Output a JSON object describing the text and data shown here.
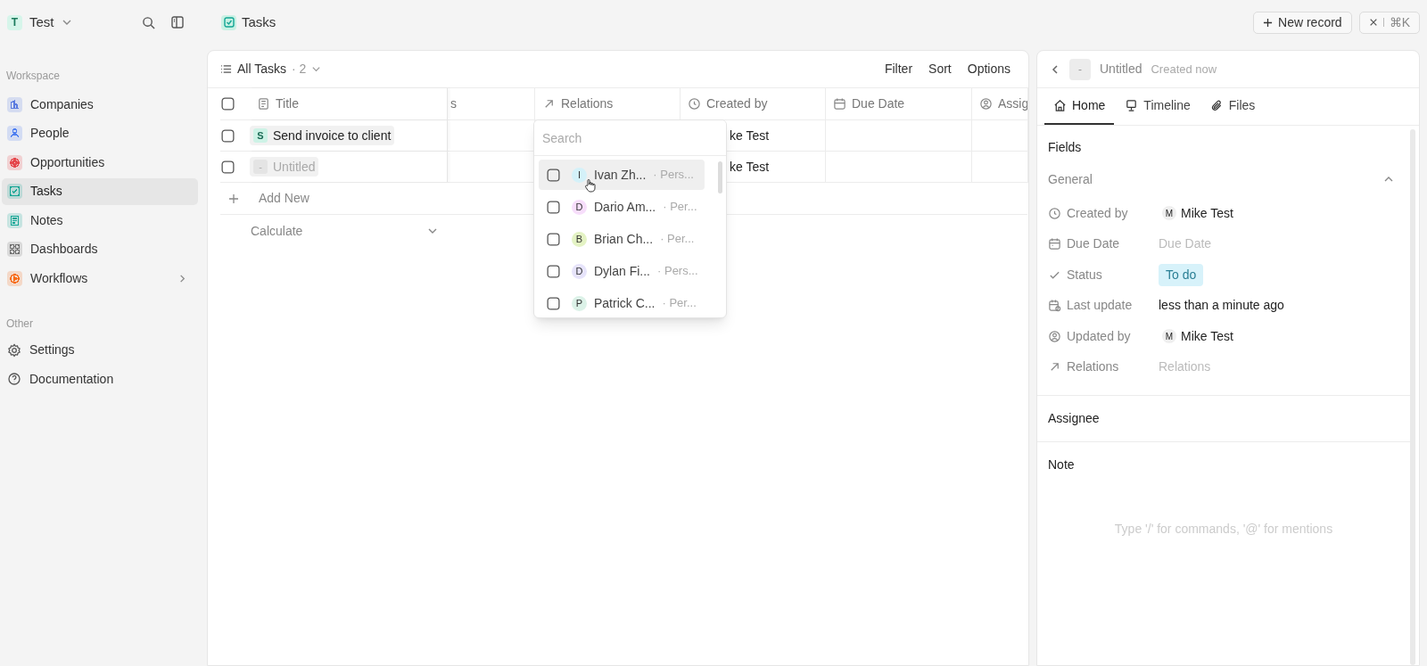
{
  "workspace": {
    "initial": "T",
    "name": "Test"
  },
  "sidebar": {
    "sections": [
      {
        "title": "Workspace",
        "items": [
          {
            "label": "Companies",
            "selected": false,
            "expandable": false,
            "color": "#5b7be0"
          },
          {
            "label": "People",
            "selected": false,
            "expandable": false,
            "color": "#4f7ff0"
          },
          {
            "label": "Opportunities",
            "selected": false,
            "expandable": false,
            "color": "#e5484d"
          },
          {
            "label": "Tasks",
            "selected": true,
            "expandable": false,
            "color": "#12a594"
          },
          {
            "label": "Notes",
            "selected": false,
            "expandable": false,
            "color": "#12a594"
          },
          {
            "label": "Dashboards",
            "selected": false,
            "expandable": false,
            "color": "#6f6f6f"
          },
          {
            "label": "Workflows",
            "selected": false,
            "expandable": true,
            "color": "#f76b15"
          }
        ]
      },
      {
        "title": "Other",
        "items": [
          {
            "label": "Settings",
            "selected": false,
            "expandable": false
          },
          {
            "label": "Documentation",
            "selected": false,
            "expandable": false
          }
        ]
      }
    ]
  },
  "page": {
    "title": "Tasks"
  },
  "top_buttons": [
    {
      "kind": "new",
      "label": "New record"
    },
    {
      "kind": "close",
      "label": "⌘K"
    }
  ],
  "view": {
    "name": "All Tasks",
    "count": "· 2",
    "actions": [
      "Filter",
      "Sort",
      "Options"
    ]
  },
  "table": {
    "select_all_checked": false,
    "columns": [
      "Title",
      "s",
      "Relations",
      "Created by",
      "Due Date",
      "Assig"
    ],
    "rows": [
      {
        "checked": false,
        "initial": "S",
        "title": "Send invoice to client",
        "empty": false,
        "created_by": "ke Test"
      },
      {
        "checked": false,
        "initial": "-",
        "title": "Untitled",
        "empty": true,
        "created_by": "ke Test"
      }
    ],
    "add_new": "Add New",
    "calculate": "Calculate"
  },
  "relations_dropdown": {
    "placeholder": "Search",
    "options": [
      {
        "initial": "I",
        "name": "Ivan Zh...",
        "type": "· Pers...",
        "color": "#d4f1f9",
        "checked": false,
        "highlighted": true
      },
      {
        "initial": "D",
        "name": "Dario Am...",
        "type": "· Per...",
        "color": "#f7defb",
        "checked": false,
        "highlighted": false
      },
      {
        "initial": "B",
        "name": "Brian Ch...",
        "type": "· Per...",
        "color": "#e4f3c4",
        "checked": false,
        "highlighted": false
      },
      {
        "initial": "D",
        "name": "Dylan Fi...",
        "type": "· Pers...",
        "color": "#e7e4fb",
        "checked": false,
        "highlighted": false
      },
      {
        "initial": "P",
        "name": "Patrick C...",
        "type": "· Per...",
        "color": "#dcf2e8",
        "checked": false,
        "highlighted": false
      }
    ]
  },
  "record": {
    "icon": "-",
    "title": "Untitled",
    "subtitle": "Created now",
    "tabs": [
      {
        "label": "Home",
        "selected": true
      },
      {
        "label": "Timeline",
        "selected": false
      },
      {
        "label": "Files",
        "selected": false
      }
    ],
    "fields_heading": "Fields",
    "group": {
      "title": "General",
      "expanded": true,
      "fields": [
        {
          "label": "Created by",
          "kind": "person",
          "initial": "M",
          "value": "Mike Test"
        },
        {
          "label": "Due Date",
          "kind": "empty",
          "placeholder": "Due Date"
        },
        {
          "label": "Status",
          "kind": "tag",
          "value": "To do"
        },
        {
          "label": "Last update",
          "kind": "text",
          "value": "less than a minute ago"
        },
        {
          "label": "Updated by",
          "kind": "person",
          "initial": "M",
          "value": "Mike Test"
        },
        {
          "label": "Relations",
          "kind": "empty",
          "placeholder": "Relations"
        }
      ]
    },
    "sections": [
      "Assignee",
      "Note"
    ],
    "note_placeholder": "Type '/' for commands, '@' for mentions"
  }
}
